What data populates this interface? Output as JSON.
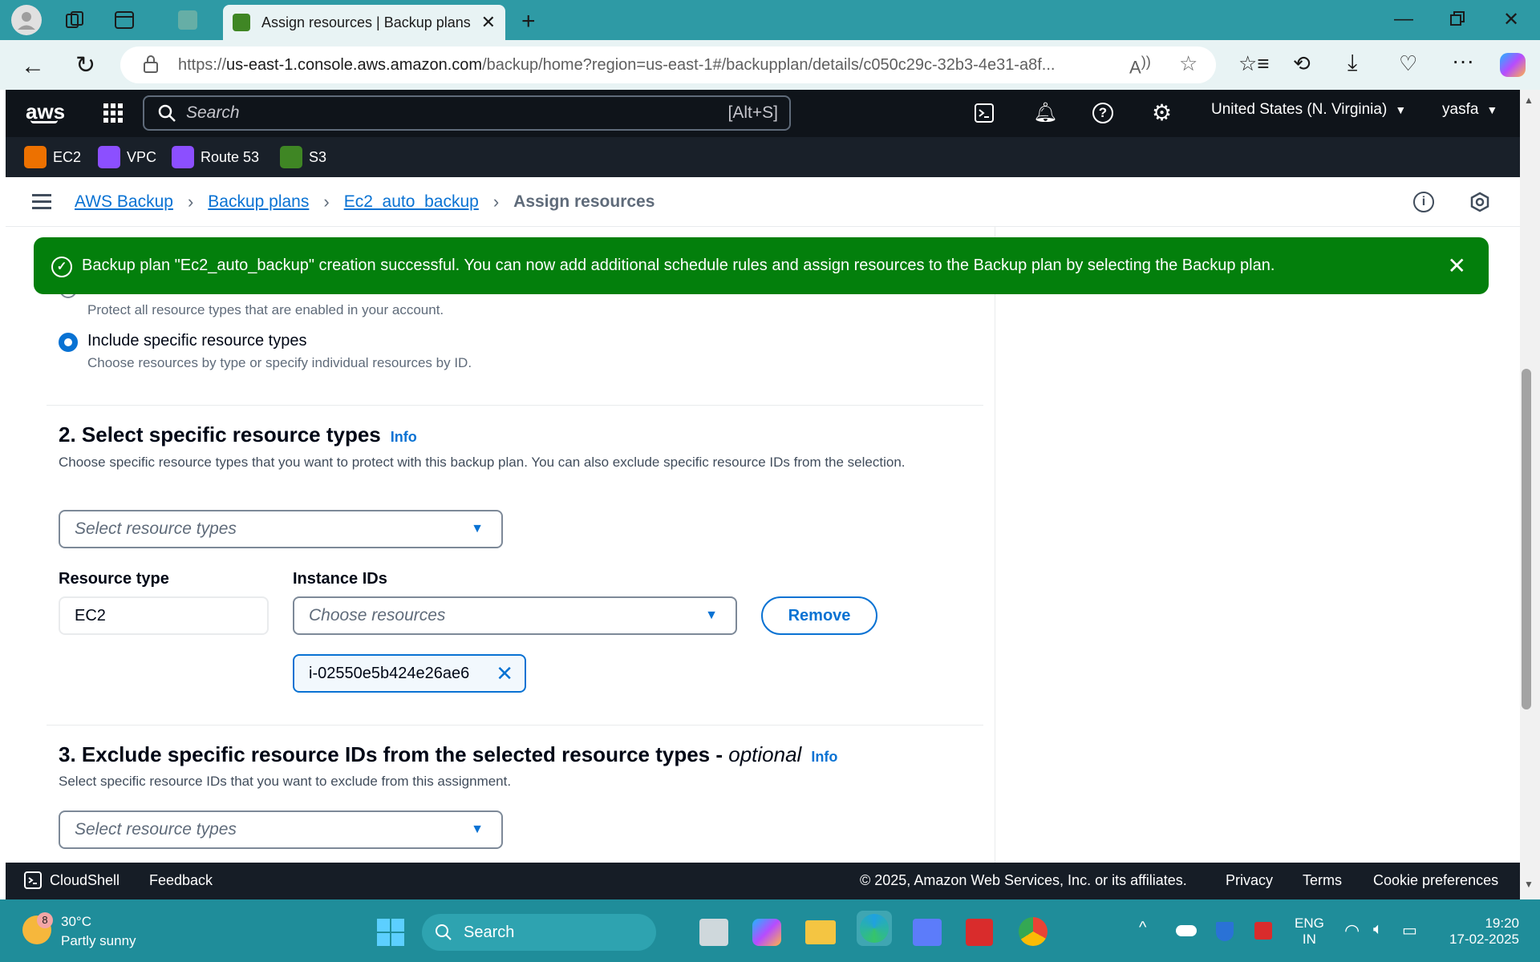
{
  "browser": {
    "tab_title": "Assign resources | Backup plans |",
    "url_prefix": "https://",
    "url_host": "us-east-1.console.aws.amazon.com",
    "url_path": "/backup/home?region=us-east-1#/backupplan/details/c050c29c-32b3-4e31-a8f..."
  },
  "aws": {
    "logo": "aws",
    "search_placeholder": "Search",
    "search_shortcut": "[Alt+S]",
    "region": "United States (N. Virginia)",
    "user": "yasfa",
    "favorites": [
      {
        "label": "EC2",
        "color": "#ed7100"
      },
      {
        "label": "VPC",
        "color": "#8c4fff"
      },
      {
        "label": "Route 53",
        "color": "#8c4fff"
      },
      {
        "label": "S3",
        "color": "#3f8624"
      }
    ]
  },
  "breadcrumb": {
    "items": [
      "AWS Backup",
      "Backup plans",
      "Ec2_auto_backup"
    ],
    "current": "Assign resources"
  },
  "flash": {
    "message": "Backup plan \"Ec2_auto_backup\" creation successful. You can now add additional schedule rules and assign resources to the Backup plan by selecting the Backup plan."
  },
  "section1": {
    "option_all_desc": "Protect all resource types that are enabled in your account.",
    "option_specific_label": "Include specific resource types",
    "option_specific_desc": "Choose resources by type or specify individual resources by ID."
  },
  "section2": {
    "title": "2. Select specific resource types",
    "info": "Info",
    "description": "Choose specific resource types that you want to protect with this backup plan. You can also exclude specific resource IDs from the selection.",
    "select_placeholder": "Select resource types",
    "resource_type_label": "Resource type",
    "resource_type_value": "EC2",
    "instance_ids_label": "Instance IDs",
    "instance_ids_placeholder": "Choose resources",
    "remove_label": "Remove",
    "token": "i-02550e5b424e26ae6"
  },
  "section3": {
    "title_main": "3. Exclude specific resource IDs from the selected resource types - ",
    "title_optional": "optional",
    "info": "Info",
    "description": "Select specific resource IDs that you want to exclude from this assignment.",
    "select_placeholder": "Select resource types"
  },
  "footer": {
    "cloudshell": "CloudShell",
    "feedback": "Feedback",
    "copyright": "© 2025, Amazon Web Services, Inc. or its affiliates.",
    "privacy": "Privacy",
    "terms": "Terms",
    "cookies": "Cookie preferences"
  },
  "taskbar": {
    "weather_badge": "8",
    "temp": "30°C",
    "weather": "Partly sunny",
    "search": "Search",
    "lang_top": "ENG",
    "lang_bottom": "IN",
    "time": "19:20",
    "date": "17-02-2025"
  }
}
